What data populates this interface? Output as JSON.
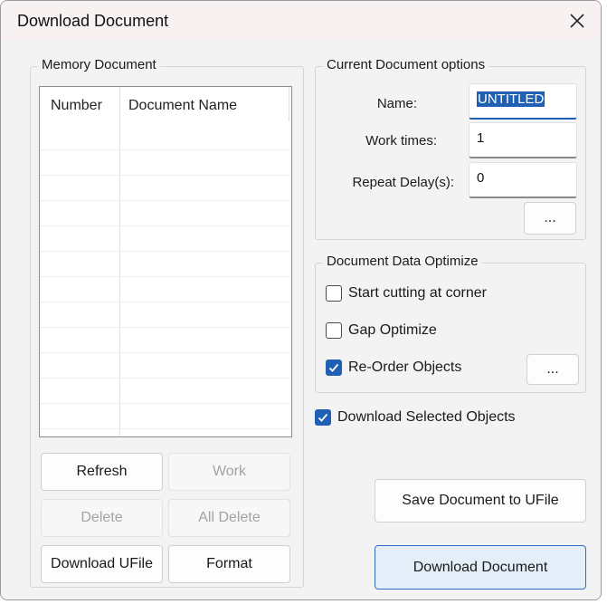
{
  "window": {
    "title": "Download Document"
  },
  "memory": {
    "group_label": "Memory Document",
    "columns": [
      "Number",
      "Document Name"
    ],
    "rows": []
  },
  "buttons": {
    "refresh": "Refresh",
    "work": "Work",
    "delete": "Delete",
    "all_delete": "All Delete",
    "download_ufile": "Download UFile",
    "format": "Format",
    "save_to_ufile": "Save Document to UFile",
    "download_document": "Download Document",
    "options_more": "...",
    "reorder_more": "..."
  },
  "current": {
    "group_label": "Current Document options",
    "name_label": "Name:",
    "name_value": "UNTITLED",
    "work_times_label": "Work times:",
    "work_times_value": "1",
    "repeat_delay_label": "Repeat Delay(s):",
    "repeat_delay_value": "0"
  },
  "optimize": {
    "group_label": "Document Data Optimize",
    "start_cutting": {
      "label": "Start cutting at corner",
      "checked": false
    },
    "gap_optimize": {
      "label": "Gap Optimize",
      "checked": false
    },
    "reorder": {
      "label": "Re-Order Objects",
      "checked": true
    }
  },
  "download_selected": {
    "label": "Download Selected Objects",
    "checked": true
  },
  "colors": {
    "accent": "#1f5fb4"
  }
}
